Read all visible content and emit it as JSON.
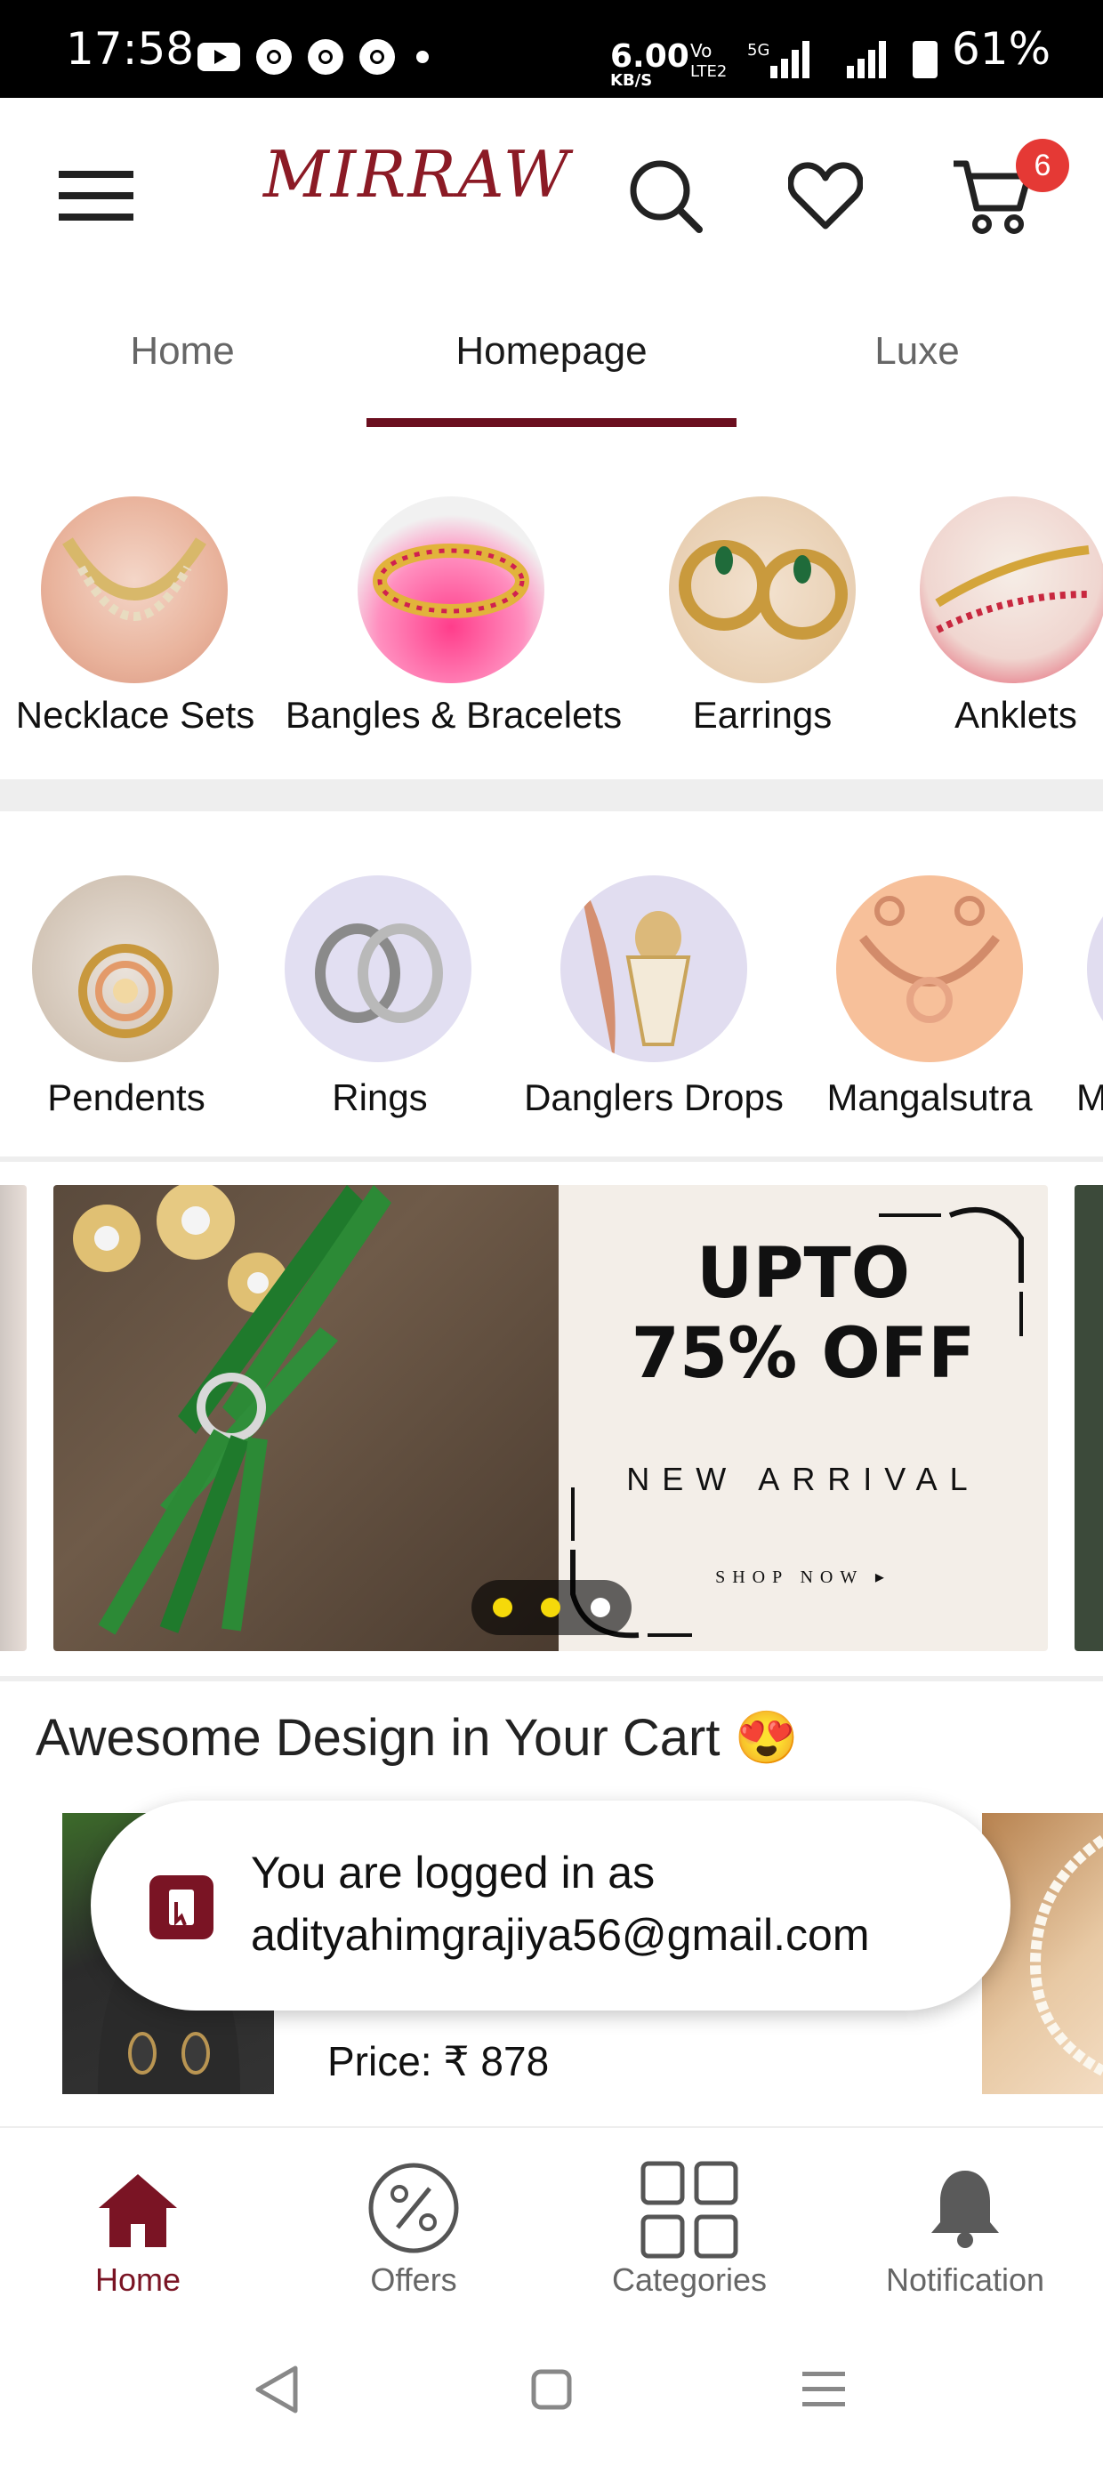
{
  "status_bar": {
    "time": "17:58",
    "net_speed": "6.00",
    "net_unit": "KB/S",
    "battery": "61%"
  },
  "header": {
    "logo": "MIRRAW",
    "cart_count": "6",
    "icons": [
      "menu-icon",
      "search-icon",
      "heart-icon",
      "cart-icon"
    ]
  },
  "tabs": [
    {
      "label": "Home",
      "active": false
    },
    {
      "label": "Homepage",
      "active": true
    },
    {
      "label": "Luxe",
      "active": false
    }
  ],
  "categories_row1": [
    {
      "label": "Necklace Sets"
    },
    {
      "label": "Bangles & Bracelets"
    },
    {
      "label": "Earrings"
    },
    {
      "label": "Anklets"
    }
  ],
  "categories_row2": [
    {
      "label": "Pendents"
    },
    {
      "label": "Rings"
    },
    {
      "label": "Danglers Drops"
    },
    {
      "label": "Mangalsutra"
    },
    {
      "label": "M"
    }
  ],
  "banner": {
    "line1": "UPTO",
    "line2": "75% OFF",
    "subtitle": "NEW ARRIVAL",
    "cta": "SHOP NOW ▸"
  },
  "section": {
    "title": "Awesome Design in Your Cart 😍",
    "price": "Price: ₹ 878"
  },
  "toast": {
    "line1": "You are logged in as",
    "line2": "adityahimgrajiya56@gmail.com"
  },
  "bottom_nav": [
    {
      "label": "Home",
      "active": true
    },
    {
      "label": "Offers",
      "active": false
    },
    {
      "label": "Categories",
      "active": false
    },
    {
      "label": "Notification",
      "active": false
    }
  ],
  "colors": {
    "brand": "#7a1424",
    "badge": "#e53935",
    "dot_active": "#f5d90a"
  }
}
